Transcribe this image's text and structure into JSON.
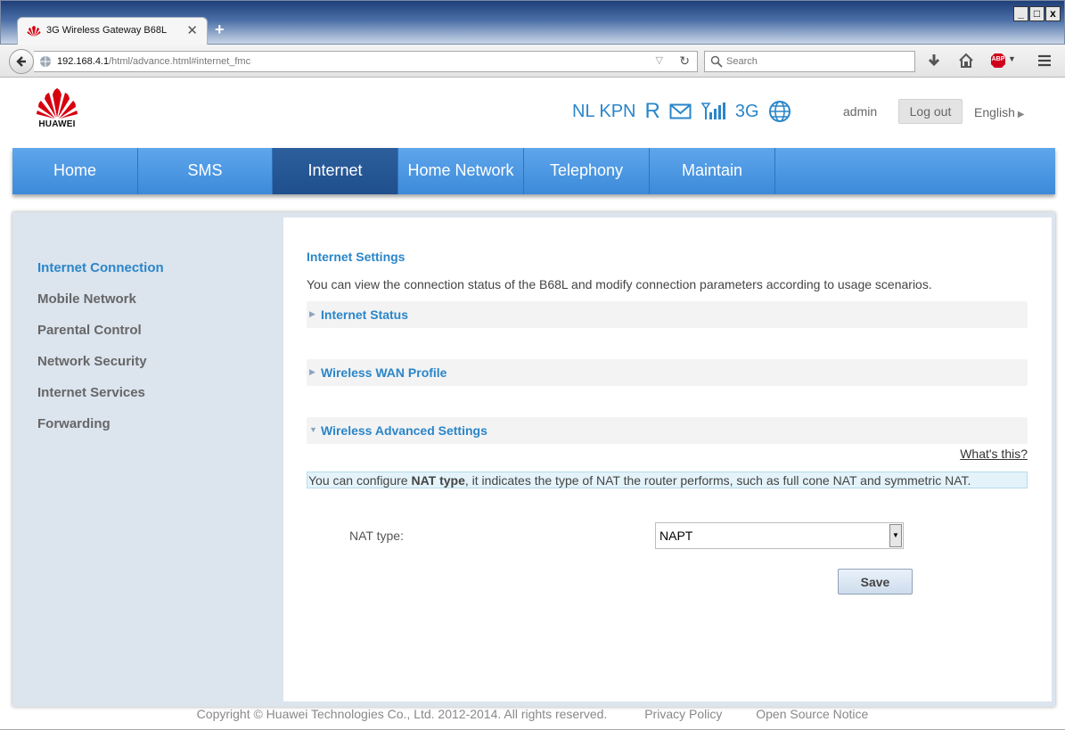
{
  "browser": {
    "tab_title": "3G Wireless Gateway B68L",
    "close_glyph": "✕",
    "newtab_glyph": "+",
    "url_host": "192.168.4.1",
    "url_path": "/html/advance.html#internet_fmc",
    "search_placeholder": "Search",
    "window_controls": [
      "_",
      "□",
      "x"
    ],
    "abp_label": "ABP"
  },
  "header": {
    "logo_text": "HUAWEI",
    "operator": "NL KPN",
    "roaming": "R",
    "network_type": "3G",
    "user": "admin",
    "logout_label": "Log out",
    "language": "English",
    "accent_color": "#2a86c9"
  },
  "nav": {
    "items": [
      {
        "label": "Home"
      },
      {
        "label": "SMS"
      },
      {
        "label": "Internet",
        "active": true
      },
      {
        "label": "Home Network"
      },
      {
        "label": "Telephony"
      },
      {
        "label": "Maintain"
      }
    ]
  },
  "sidebar": {
    "items": [
      {
        "label": "Internet Connection",
        "active": true
      },
      {
        "label": "Mobile Network"
      },
      {
        "label": "Parental Control"
      },
      {
        "label": "Network Security"
      },
      {
        "label": "Internet Services"
      },
      {
        "label": "Forwarding"
      }
    ]
  },
  "main": {
    "title": "Internet Settings",
    "description": "You can view the connection status of the B68L and modify connection parameters according to usage scenarios.",
    "sections": [
      {
        "title": "Internet Status",
        "expanded": false
      },
      {
        "title": "Wireless WAN Profile",
        "expanded": false
      },
      {
        "title": "Wireless Advanced Settings",
        "expanded": true
      }
    ],
    "whats_this": "What's this?",
    "notice_prefix": "You can configure ",
    "notice_bold": "NAT type",
    "notice_suffix": ", it indicates the type of NAT the router performs, such as full cone NAT and symmetric NAT.",
    "nat_label": "NAT type:",
    "nat_value": "NAPT",
    "save_label": "Save"
  },
  "footer": {
    "copyright": "Copyright © Huawei Technologies Co., Ltd. 2012-2014. All rights reserved.",
    "privacy": "Privacy Policy",
    "open_source": "Open Source Notice"
  }
}
